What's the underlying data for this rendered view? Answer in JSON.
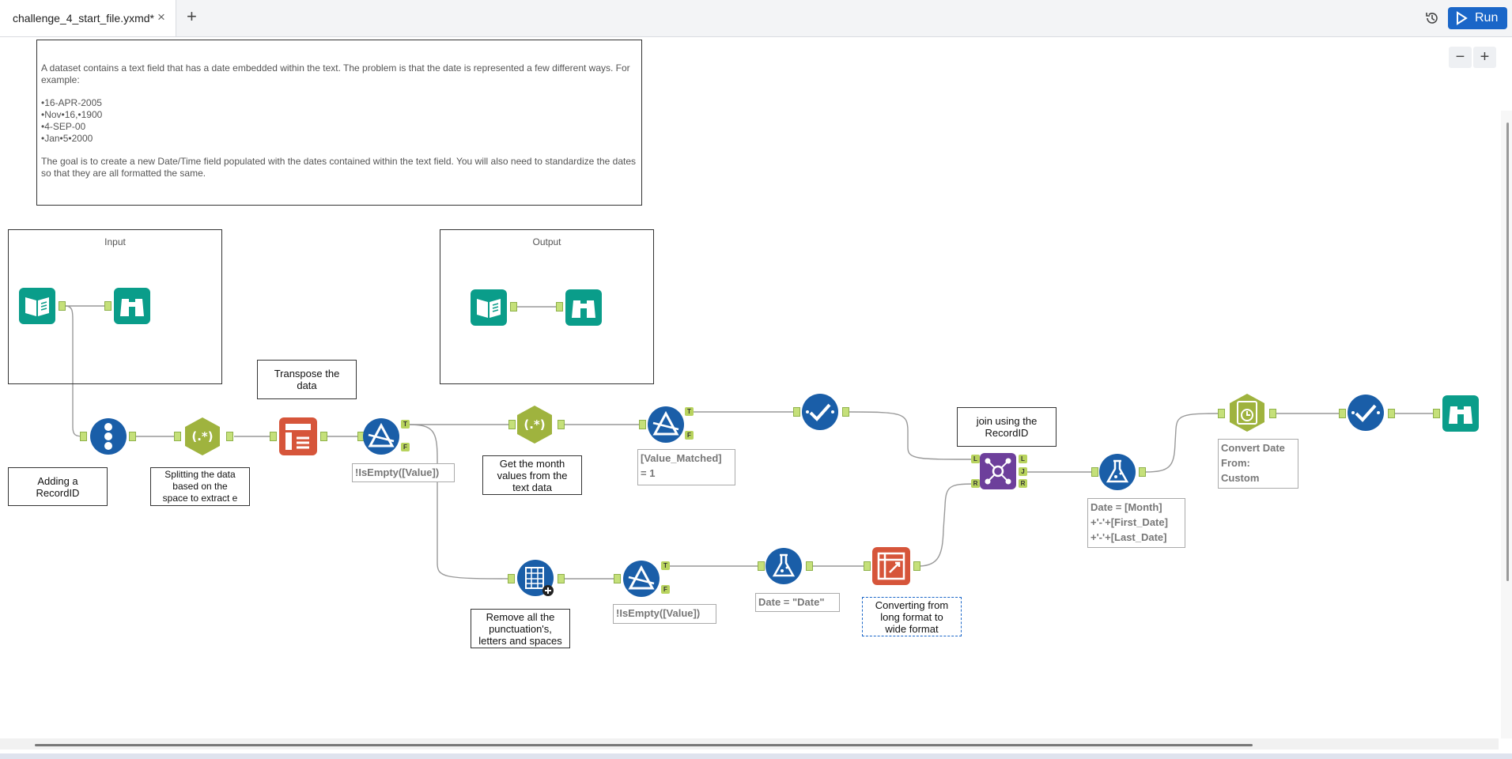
{
  "tab": {
    "title": "challenge_4_start_file.yxmd*",
    "close": "×",
    "add": "+"
  },
  "toolbar": {
    "run_label": "Run"
  },
  "zoom": {
    "out": "−",
    "in": "+"
  },
  "description": {
    "intro": "A dataset contains a text field that has a date embedded within the text. The problem is that the date is represented a few different ways. For example:",
    "examples": [
      "•16-APR-2005",
      "•Nov•16,•1900",
      "•4-SEP-00",
      "•Jan•5•2000"
    ],
    "goal": "The goal is to create a new Date/Time field populated with the dates contained within the text field. You will also need to standardize the dates so that they are all formatted the same."
  },
  "containers": {
    "input": "Input",
    "output": "Output"
  },
  "comments": {
    "transpose": "Transpose the\ndata",
    "record_id": "Adding a\nRecordID",
    "splitting": "Splitting the data\nbased on the\nspace to extract e",
    "month": "Get the month\nvalues from the\ntext data",
    "join": "join using the\nRecordID",
    "remove": "Remove all the\npunctuation's,\nletters and spaces",
    "converting": "Converting from\nlong format to\nwide format"
  },
  "annotations": {
    "filter1": "!IsEmpty([Value])",
    "filter2": "[Value_Matched]\n= 1",
    "filter3": "!IsEmpty([Value])",
    "formula1": "Date = \"Date\"",
    "formula2": "Date = [Month]\n+'-'+[First_Date]\n+'-'+[Last_Date]",
    "datetime": "Convert Date\nFrom:\nCustom"
  },
  "anchor_labels": {
    "true": "T",
    "false": "F",
    "left": "L",
    "join": "J",
    "right": "R"
  },
  "colors": {
    "input_teal": "#0a9d8a",
    "prep_blue": "#1a5ea8",
    "parse_green": "#9fb33e",
    "transform_orange": "#d6553a",
    "join_purple": "#6d3f9b",
    "run_blue": "#1a66c8"
  }
}
